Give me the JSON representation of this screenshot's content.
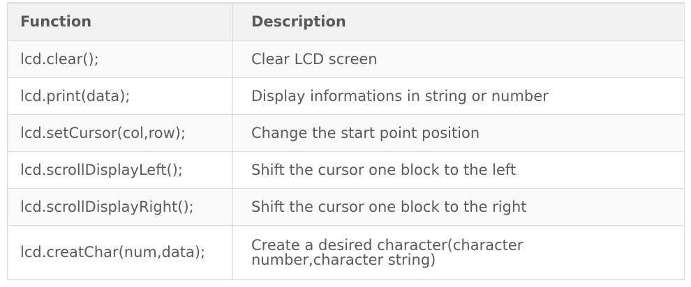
{
  "table": {
    "headers": {
      "function": "Function",
      "description": "Description"
    },
    "rows": [
      {
        "function": "lcd.clear();",
        "description": "Clear LCD screen"
      },
      {
        "function": "lcd.print(data);",
        "description": "Display informations in string or number"
      },
      {
        "function": "lcd.setCursor(col,row);",
        "description": "Change the start point position"
      },
      {
        "function": "lcd.scrollDisplayLeft();",
        "description": "Shift the cursor one block to the left"
      },
      {
        "function": "lcd.scrollDisplayRight();",
        "description": "Shift the cursor one block to the right"
      },
      {
        "function": "lcd.creatChar(num,data);",
        "description": "Create a desired character(character number,character string)"
      }
    ]
  },
  "colors": {
    "header_bg": "#f1f1f1",
    "border": "#dcdcdc",
    "text": "#555555"
  }
}
